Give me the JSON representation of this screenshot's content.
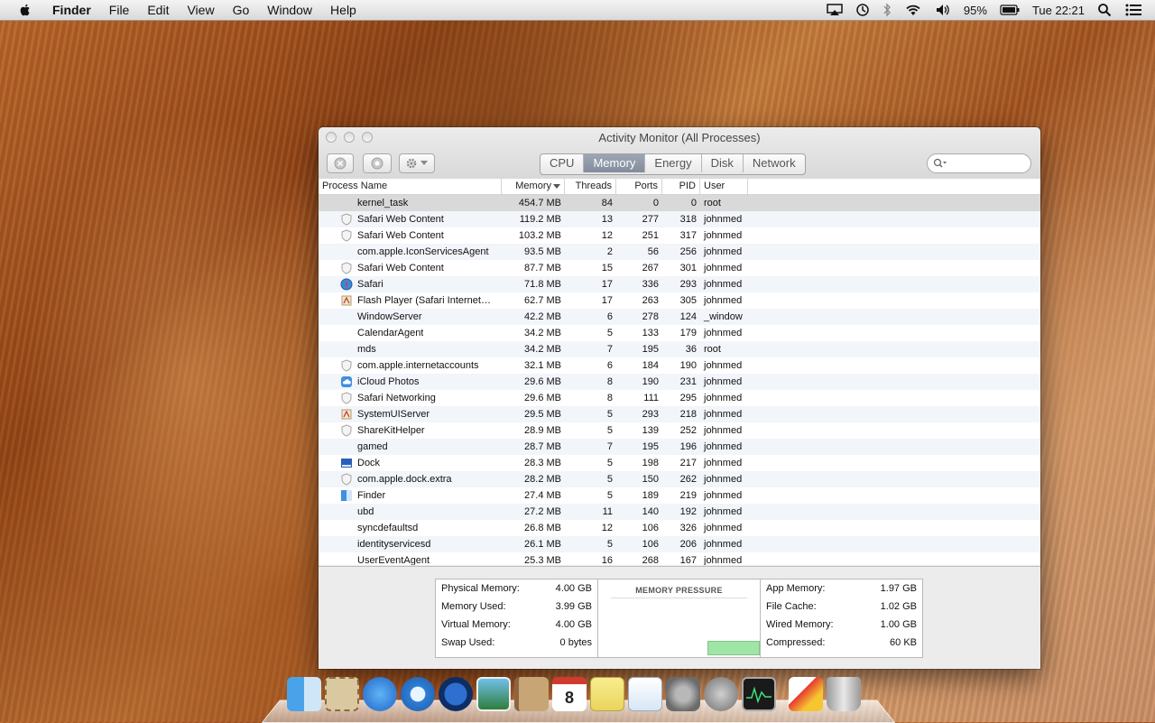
{
  "menubar": {
    "app_name": "Finder",
    "items": [
      "File",
      "Edit",
      "View",
      "Go",
      "Window",
      "Help"
    ],
    "battery": "95%",
    "clock": "Tue 22:21"
  },
  "window": {
    "title": "Activity Monitor (All Processes)",
    "tabs": [
      "CPU",
      "Memory",
      "Energy",
      "Disk",
      "Network"
    ],
    "active_tab": "Memory",
    "search_placeholder": ""
  },
  "columns": [
    "Process Name",
    "Memory",
    "Threads",
    "Ports",
    "PID",
    "User"
  ],
  "sort_column": "Memory",
  "processes": [
    {
      "name": "kernel_task",
      "icon": "none",
      "memory": "454.7 MB",
      "threads": "84",
      "ports": "0",
      "pid": "0",
      "user": "root"
    },
    {
      "name": "Safari Web Content",
      "icon": "shield-icon",
      "memory": "119.2 MB",
      "threads": "13",
      "ports": "277",
      "pid": "318",
      "user": "johnmed"
    },
    {
      "name": "Safari Web Content",
      "icon": "shield-icon",
      "memory": "103.2 MB",
      "threads": "12",
      "ports": "251",
      "pid": "317",
      "user": "johnmed"
    },
    {
      "name": "com.apple.IconServicesAgent",
      "icon": "none",
      "memory": "93.5 MB",
      "threads": "2",
      "ports": "56",
      "pid": "256",
      "user": "johnmed"
    },
    {
      "name": "Safari Web Content",
      "icon": "shield-icon",
      "memory": "87.7 MB",
      "threads": "15",
      "ports": "267",
      "pid": "301",
      "user": "johnmed"
    },
    {
      "name": "Safari",
      "icon": "safari-icon",
      "memory": "71.8 MB",
      "threads": "17",
      "ports": "336",
      "pid": "293",
      "user": "johnmed"
    },
    {
      "name": "Flash Player (Safari Internet…",
      "icon": "app-icon",
      "memory": "62.7 MB",
      "threads": "17",
      "ports": "263",
      "pid": "305",
      "user": "johnmed"
    },
    {
      "name": "WindowServer",
      "icon": "none",
      "memory": "42.2 MB",
      "threads": "6",
      "ports": "278",
      "pid": "124",
      "user": "_window"
    },
    {
      "name": "CalendarAgent",
      "icon": "none",
      "memory": "34.2 MB",
      "threads": "5",
      "ports": "133",
      "pid": "179",
      "user": "johnmed"
    },
    {
      "name": "mds",
      "icon": "none",
      "memory": "34.2 MB",
      "threads": "7",
      "ports": "195",
      "pid": "36",
      "user": "root"
    },
    {
      "name": "com.apple.internetaccounts",
      "icon": "shield-icon",
      "memory": "32.1 MB",
      "threads": "6",
      "ports": "184",
      "pid": "190",
      "user": "johnmed"
    },
    {
      "name": "iCloud Photos",
      "icon": "cloud-icon",
      "memory": "29.6 MB",
      "threads": "8",
      "ports": "190",
      "pid": "231",
      "user": "johnmed"
    },
    {
      "name": "Safari Networking",
      "icon": "shield-icon",
      "memory": "29.6 MB",
      "threads": "8",
      "ports": "111",
      "pid": "295",
      "user": "johnmed"
    },
    {
      "name": "SystemUIServer",
      "icon": "app-icon",
      "memory": "29.5 MB",
      "threads": "5",
      "ports": "293",
      "pid": "218",
      "user": "johnmed"
    },
    {
      "name": "ShareKitHelper",
      "icon": "shield-icon",
      "memory": "28.9 MB",
      "threads": "5",
      "ports": "139",
      "pid": "252",
      "user": "johnmed"
    },
    {
      "name": "gamed",
      "icon": "none",
      "memory": "28.7 MB",
      "threads": "7",
      "ports": "195",
      "pid": "196",
      "user": "johnmed"
    },
    {
      "name": "Dock",
      "icon": "dock-icon",
      "memory": "28.3 MB",
      "threads": "5",
      "ports": "198",
      "pid": "217",
      "user": "johnmed"
    },
    {
      "name": "com.apple.dock.extra",
      "icon": "shield-icon",
      "memory": "28.2 MB",
      "threads": "5",
      "ports": "150",
      "pid": "262",
      "user": "johnmed"
    },
    {
      "name": "Finder",
      "icon": "finder-icon",
      "memory": "27.4 MB",
      "threads": "5",
      "ports": "189",
      "pid": "219",
      "user": "johnmed"
    },
    {
      "name": "ubd",
      "icon": "none",
      "memory": "27.2 MB",
      "threads": "11",
      "ports": "140",
      "pid": "192",
      "user": "johnmed"
    },
    {
      "name": "syncdefaultsd",
      "icon": "none",
      "memory": "26.8 MB",
      "threads": "12",
      "ports": "106",
      "pid": "326",
      "user": "johnmed"
    },
    {
      "name": "identityservicesd",
      "icon": "none",
      "memory": "26.1 MB",
      "threads": "5",
      "ports": "106",
      "pid": "206",
      "user": "johnmed"
    },
    {
      "name": "UserEventAgent",
      "icon": "none",
      "memory": "25.3 MB",
      "threads": "16",
      "ports": "268",
      "pid": "167",
      "user": "johnmed"
    }
  ],
  "stats_left": [
    {
      "label": "Physical Memory:",
      "value": "4.00 GB"
    },
    {
      "label": "Memory Used:",
      "value": "3.99 GB"
    },
    {
      "label": "Virtual Memory:",
      "value": "4.00 GB"
    },
    {
      "label": "Swap Used:",
      "value": "0 bytes"
    }
  ],
  "memory_pressure": {
    "title": "MEMORY PRESSURE",
    "color": "#9ee5a6"
  },
  "stats_right": [
    {
      "label": "App Memory:",
      "value": "1.97 GB"
    },
    {
      "label": "File Cache:",
      "value": "1.02 GB"
    },
    {
      "label": "Wired Memory:",
      "value": "1.00 GB"
    },
    {
      "label": "Compressed:",
      "value": "60 KB"
    }
  ],
  "calendar_day": "8",
  "dock": [
    "finder-icon",
    "mail-stamp-icon",
    "itunes-icon",
    "safari-icon",
    "movie-icon",
    "photo-icon",
    "contacts-icon",
    "calendar-icon",
    "notes-icon",
    "preview-icon",
    "system-preferences-icon",
    "launchpad-icon",
    "activity-monitor-icon",
    "separator",
    "papers-icon",
    "trash-icon"
  ]
}
